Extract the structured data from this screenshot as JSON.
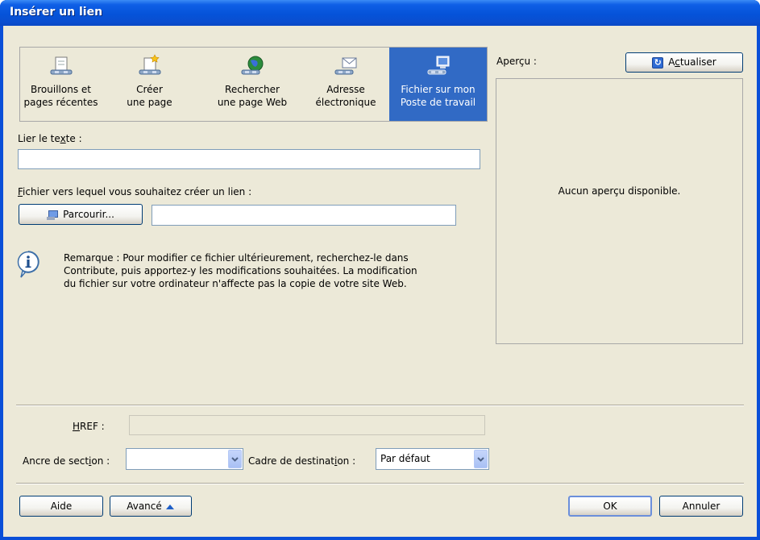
{
  "window": {
    "title": "Insérer un lien"
  },
  "link_types": [
    {
      "line1": "Brouillons et",
      "line2": "pages récentes",
      "icon": "drafts-icon"
    },
    {
      "line1": "Créer",
      "line2": "une page",
      "icon": "new-page-icon"
    },
    {
      "line1": "Rechercher",
      "line2": "une page Web",
      "icon": "web-search-icon"
    },
    {
      "line1": "Adresse",
      "line2": "électronique",
      "icon": "email-icon"
    },
    {
      "line1": "Fichier sur mon",
      "line2": "Poste de travail",
      "icon": "computer-file-icon",
      "selected": true
    }
  ],
  "link_text": {
    "label_pre": "Lier le te",
    "label_u": "x",
    "label_post": "te :",
    "value": ""
  },
  "file": {
    "label_u": "F",
    "label_post": "ichier vers lequel vous souhaitez créer un lien :",
    "browse_label": "Parcourir...",
    "value": ""
  },
  "note": {
    "line1": "Remarque : Pour modifier ce fichier ultérieurement, recherchez-le dans",
    "line2": "Contribute, puis apportez-y les modifications souhaitées. La modification",
    "line3": "du fichier sur votre ordinateur n'affecte pas la copie de votre site Web."
  },
  "preview": {
    "label": "Aperçu :",
    "refresh_pre": "A",
    "refresh_u": "c",
    "refresh_post": "tualiser",
    "empty_text": "Aucun aperçu disponible."
  },
  "href": {
    "label_u": "H",
    "label_post": "REF :",
    "value": ""
  },
  "anchor": {
    "label_pre": "Ancre de sect",
    "label_u": "i",
    "label_post": "on :",
    "value": ""
  },
  "target_frame": {
    "label_pre": "Cadre de destinat",
    "label_u": "i",
    "label_post": "on :",
    "value": "Par défaut"
  },
  "buttons": {
    "help": "Aide",
    "advanced": "Avancé",
    "ok": "OK",
    "cancel": "Annuler"
  },
  "colors": {
    "title_bar": "#0a4fd8",
    "selection": "#316ac5",
    "face": "#ece9d8"
  }
}
